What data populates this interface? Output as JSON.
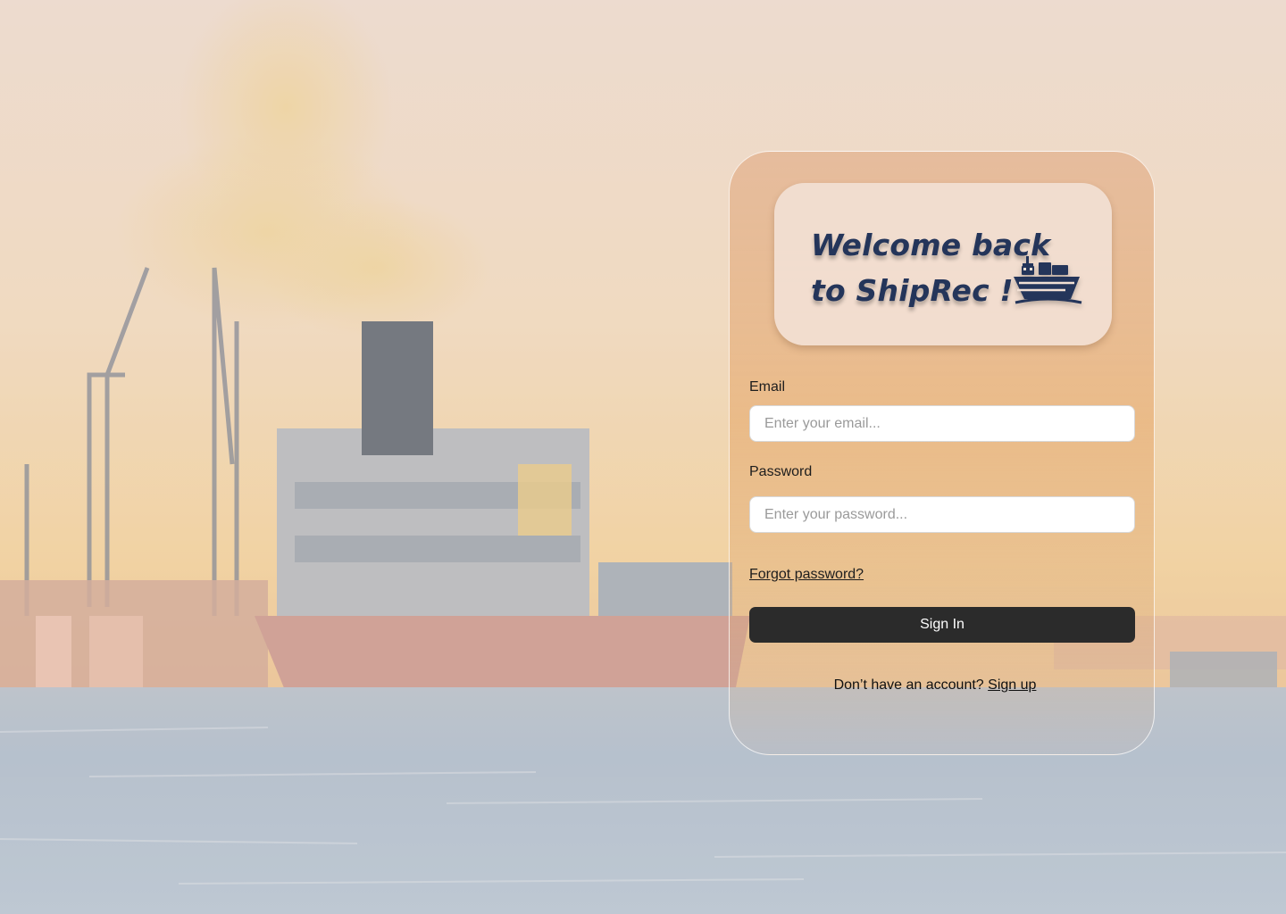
{
  "welcome": {
    "line1": "Welcome back",
    "line2": "to ShipRec !",
    "icon": "cargo-ship-icon"
  },
  "form": {
    "email_label": "Email",
    "email_placeholder": "Enter your email...",
    "email_value": "",
    "password_label": "Password",
    "password_placeholder": "Enter your password...",
    "password_value": "",
    "forgot_label": "Forgot password?",
    "signin_label": "Sign In",
    "signup_prompt": "Don’t have an account?",
    "signup_label": "Sign up"
  },
  "colors": {
    "title": "#24355a",
    "button": "#2b2b2b",
    "card_tint": "#e2b08c"
  }
}
